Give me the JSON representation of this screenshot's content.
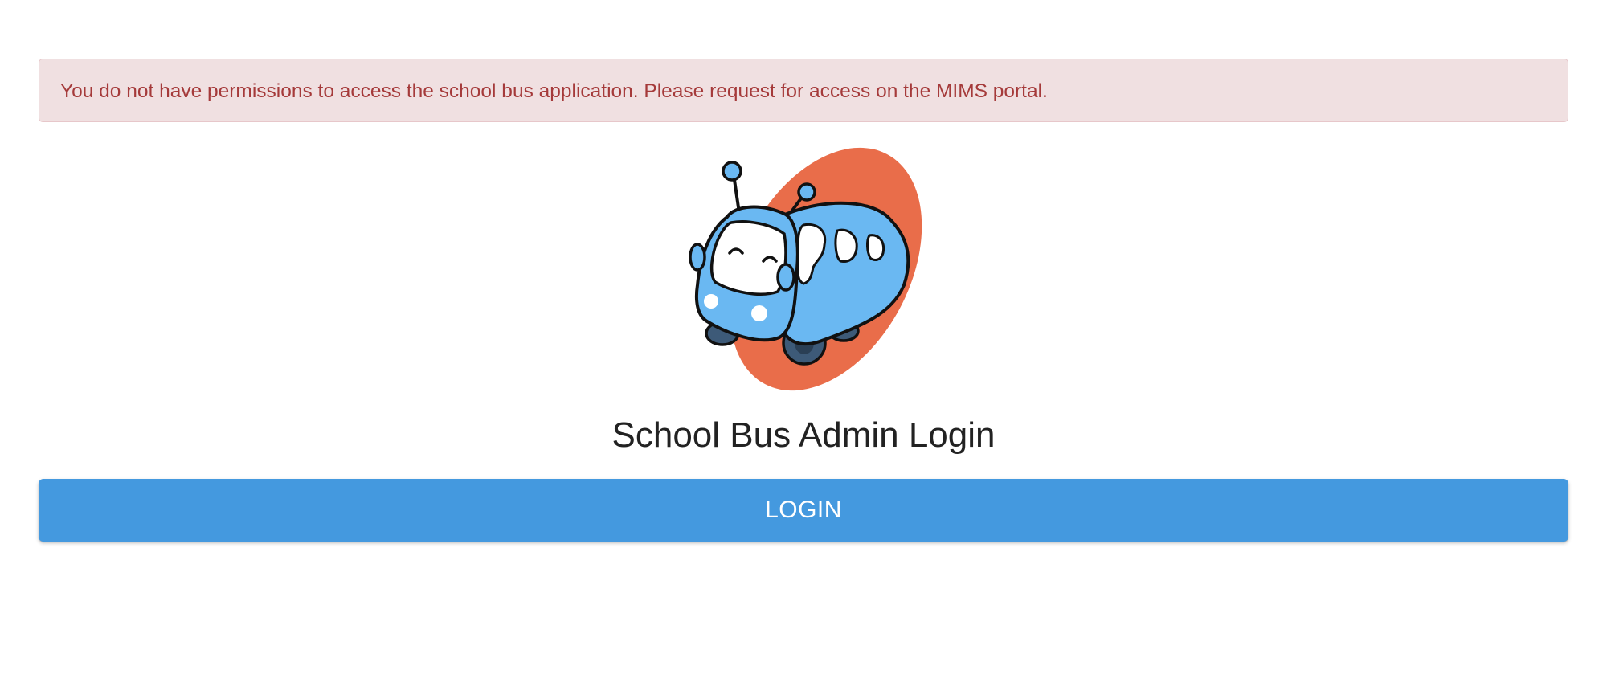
{
  "alert": {
    "message": "You do not have permissions to access the school bus application. Please request for access on the MIMS portal."
  },
  "logo": {
    "icon": "school-bus-mascot-icon",
    "colors": {
      "blob": "#e96d4a",
      "bus": "#6ab8f2",
      "window": "#ffffff",
      "outline": "#111111",
      "wheel": "#3d5a78"
    }
  },
  "title": "School Bus Admin Login",
  "login_button": {
    "label": "LOGIN",
    "color": "#4499df"
  },
  "colors": {
    "alert_background": "#f0e0e1",
    "alert_text": "#a53a3a",
    "page_background": "#ffffff"
  }
}
